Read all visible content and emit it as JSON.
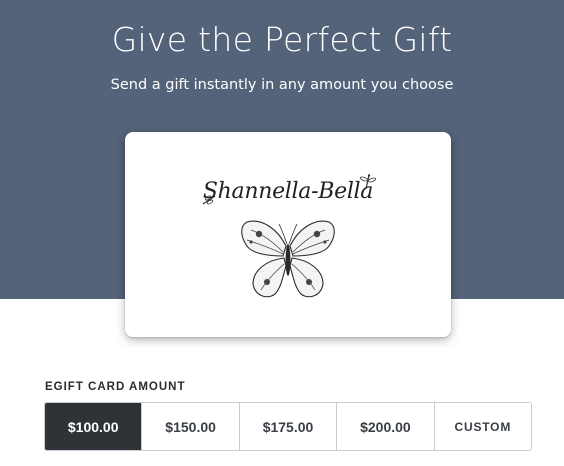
{
  "hero": {
    "title": "Give the Perfect Gift",
    "subtitle": "Send a gift instantly in any amount you choose",
    "background_color": "#546379"
  },
  "card": {
    "brand_name": "Shannella-Bella",
    "icons": [
      "butterfly-icon",
      "dragonfly-icon"
    ]
  },
  "amount": {
    "label": "EGIFT CARD AMOUNT",
    "selected_color": "#2f3338",
    "options": [
      {
        "label": "$100.00",
        "selected": true
      },
      {
        "label": "$150.00",
        "selected": false
      },
      {
        "label": "$175.00",
        "selected": false
      },
      {
        "label": "$200.00",
        "selected": false
      },
      {
        "label": "CUSTOM",
        "selected": false
      }
    ]
  }
}
